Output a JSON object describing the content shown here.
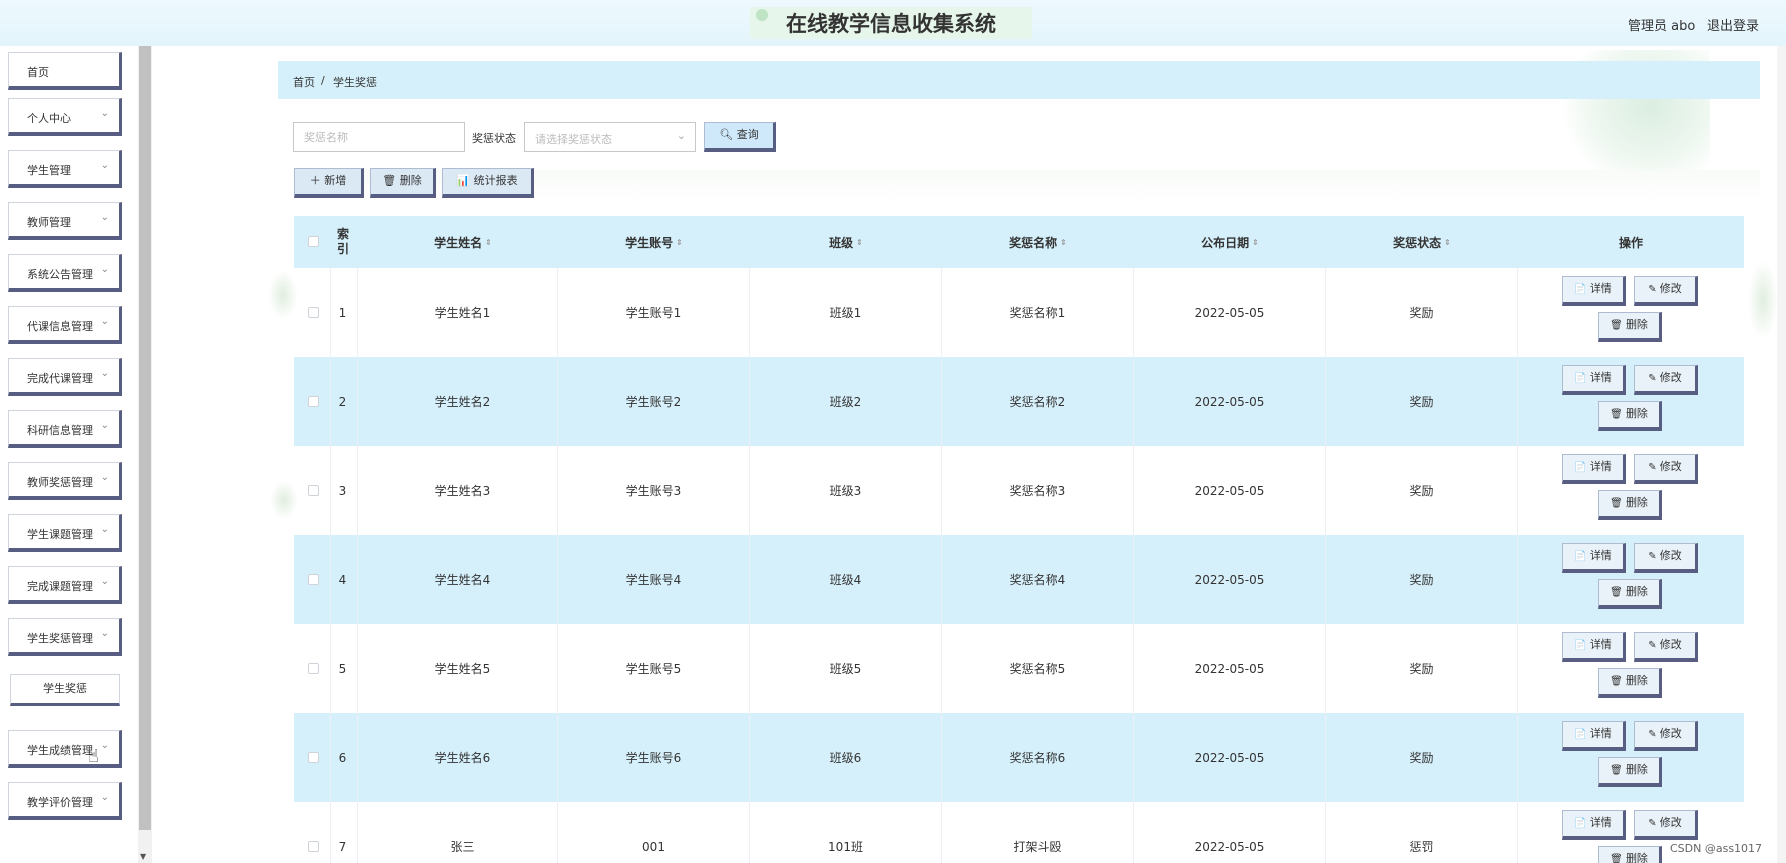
{
  "header": {
    "title": "在线教学信息收集系统",
    "admin_label": "管理员 abo",
    "logout_label": "退出登录"
  },
  "sidebar": {
    "items": [
      {
        "label": "首页",
        "has_chevron": false
      },
      {
        "label": "个人中心",
        "has_chevron": true
      },
      {
        "label": "学生管理",
        "has_chevron": true
      },
      {
        "label": "教师管理",
        "has_chevron": true
      },
      {
        "label": "系统公告管理",
        "has_chevron": true
      },
      {
        "label": "代课信息管理",
        "has_chevron": true
      },
      {
        "label": "完成代课管理",
        "has_chevron": true
      },
      {
        "label": "科研信息管理",
        "has_chevron": true
      },
      {
        "label": "教师奖惩管理",
        "has_chevron": true
      },
      {
        "label": "学生课题管理",
        "has_chevron": true
      },
      {
        "label": "完成课题管理",
        "has_chevron": true
      },
      {
        "label": "学生奖惩管理",
        "has_chevron": true
      },
      {
        "label": "学生成绩管理",
        "has_chevron": true
      },
      {
        "label": "教学评价管理",
        "has_chevron": true
      }
    ],
    "sub_item": "学生奖惩",
    "chevron_glyph": "⌄"
  },
  "breadcrumb": {
    "home": "首页",
    "separator": "/",
    "current": "学生奖惩"
  },
  "search": {
    "name_placeholder": "奖惩名称",
    "status_label": "奖惩状态",
    "status_placeholder": "请选择奖惩状态",
    "query_button": "查询",
    "query_icon": "search-icon"
  },
  "actions": {
    "add": "＋ 新增",
    "delete": "🗑 删除",
    "report": "📊 统计报表"
  },
  "table": {
    "headers": [
      "索引",
      "学生姓名",
      "学生账号",
      "班级",
      "奖惩名称",
      "公布日期",
      "奖惩状态",
      "操作"
    ],
    "index_header_line1": "索",
    "index_header_line2": "引",
    "sort_glyph": "⇕",
    "row_buttons": {
      "detail": "详情",
      "edit": "修改",
      "delete": "删除"
    },
    "rows": [
      {
        "index": "1",
        "name": "学生姓名1",
        "account": "学生账号1",
        "class": "班级1",
        "award": "奖惩名称1",
        "date": "2022-05-05",
        "status": "奖励"
      },
      {
        "index": "2",
        "name": "学生姓名2",
        "account": "学生账号2",
        "class": "班级2",
        "award": "奖惩名称2",
        "date": "2022-05-05",
        "status": "奖励"
      },
      {
        "index": "3",
        "name": "学生姓名3",
        "account": "学生账号3",
        "class": "班级3",
        "award": "奖惩名称3",
        "date": "2022-05-05",
        "status": "奖励"
      },
      {
        "index": "4",
        "name": "学生姓名4",
        "account": "学生账号4",
        "class": "班级4",
        "award": "奖惩名称4",
        "date": "2022-05-05",
        "status": "奖励"
      },
      {
        "index": "5",
        "name": "学生姓名5",
        "account": "学生账号5",
        "class": "班级5",
        "award": "奖惩名称5",
        "date": "2022-05-05",
        "status": "奖励"
      },
      {
        "index": "6",
        "name": "学生姓名6",
        "account": "学生账号6",
        "class": "班级6",
        "award": "奖惩名称6",
        "date": "2022-05-05",
        "status": "奖励"
      },
      {
        "index": "7",
        "name": "张三",
        "account": "001",
        "class": "101班",
        "award": "打架斗殴",
        "date": "2022-05-05",
        "status": "惩罚"
      }
    ]
  },
  "watermark": "CSDN @ass1017",
  "colors": {
    "accent_light": "#d6f0fb",
    "button_shadow": "#585e82",
    "header_bg": "#e3f4fc"
  }
}
